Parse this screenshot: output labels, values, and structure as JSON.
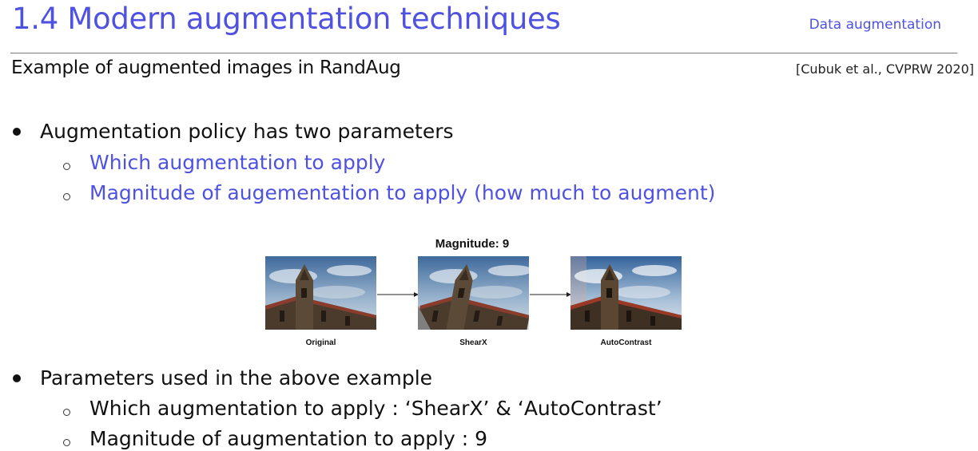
{
  "header": {
    "title": "1.4 Modern augmentation techniques",
    "section": "Data augmentation"
  },
  "subheader": {
    "subtitle": "Example of augmented images in RandAug",
    "citation": "[Cubuk et al., CVPRW 2020]"
  },
  "bullets": [
    {
      "text": "Augmentation policy has two parameters",
      "subs": [
        "Which augmentation to apply",
        "Magnitude of augementation to apply (how much to augment)"
      ]
    },
    {
      "text": "Parameters used in the above example",
      "subs": [
        "Which augmentation to apply : ‘ShearX’ & ‘AutoContrast’",
        "Magnitude of augmentation to apply : 9"
      ]
    }
  ],
  "figure": {
    "title": "Magnitude: 9",
    "captions": [
      "Original",
      "ShearX",
      "AutoContrast"
    ]
  },
  "colors": {
    "accent": "#4f52e0"
  }
}
